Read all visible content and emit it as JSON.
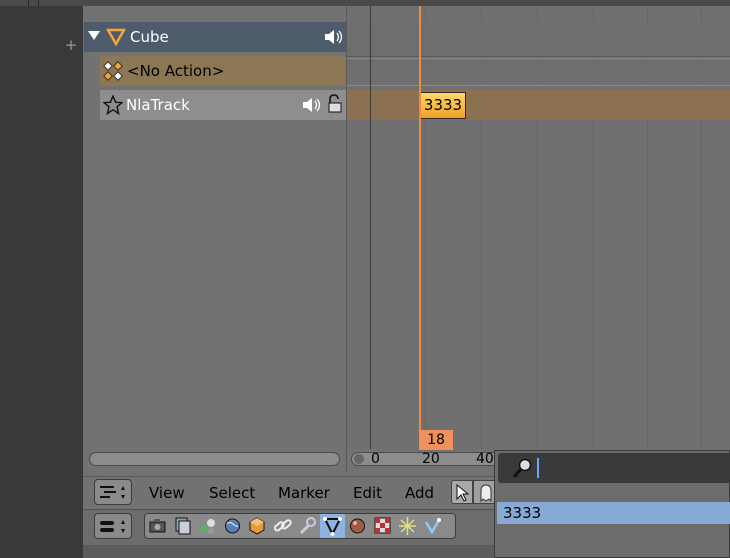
{
  "channels": {
    "object_name": "Cube",
    "action_name": "<No Action>",
    "track_name": "NlaTrack"
  },
  "timeline": {
    "strip_label": "3333",
    "current_frame": "18",
    "axis_labels": [
      "0",
      "20",
      "40"
    ],
    "playhead_color": "#f08a3c"
  },
  "header": {
    "menu": [
      "View",
      "Select",
      "Marker",
      "Edit",
      "Add"
    ]
  },
  "search_popup": {
    "value": "",
    "results": [
      "3333"
    ]
  },
  "icons": {
    "object": "triangle-object-icon",
    "action": "action-keyframes-icon",
    "track": "star-track-icon",
    "speaker": "speaker-icon",
    "lock": "padlock-icon",
    "search": "magnifier-icon"
  },
  "colors": {
    "object_row": "#4e5b6b",
    "action_row": "#8b7753",
    "strip": "#f0a020",
    "selection": "#87a9d6"
  }
}
